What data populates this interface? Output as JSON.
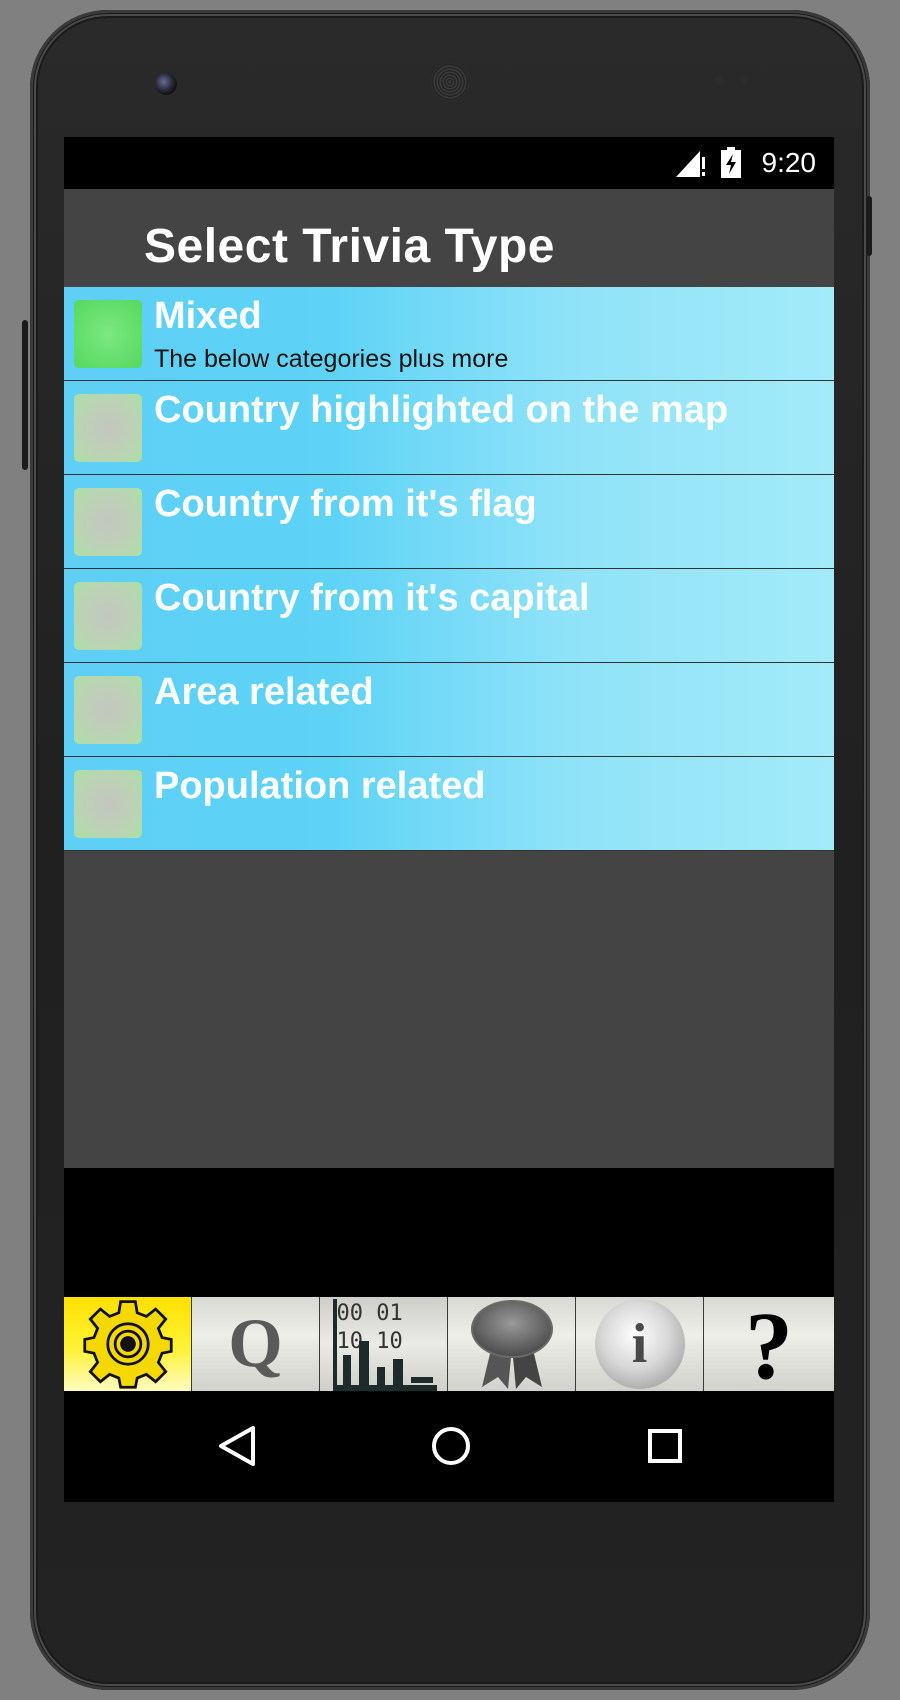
{
  "status_bar": {
    "time": "9:20",
    "icons": [
      "signal-icon",
      "battery-icon"
    ]
  },
  "header": {
    "title": "Select Trivia Type"
  },
  "trivia_types": [
    {
      "title": "Mixed",
      "subtitle": "The below categories plus more",
      "checked": true
    },
    {
      "title": "Country highlighted on the map",
      "subtitle": "",
      "checked": false
    },
    {
      "title": "Country from it's flag",
      "subtitle": "",
      "checked": false
    },
    {
      "title": "Country from it's capital",
      "subtitle": "",
      "checked": false
    },
    {
      "title": "Area related",
      "subtitle": "",
      "checked": false
    },
    {
      "title": "Population related",
      "subtitle": "",
      "checked": false
    }
  ],
  "toolbar": {
    "buttons": [
      {
        "icon": "settings-gear-icon",
        "active": true
      },
      {
        "icon": "quiz-q-icon",
        "glyph": "Q"
      },
      {
        "icon": "stats-chart-icon",
        "glyph_rows": [
          "00 01",
          "10 10"
        ]
      },
      {
        "icon": "award-ribbon-icon"
      },
      {
        "icon": "info-icon",
        "glyph": "i"
      },
      {
        "icon": "help-icon",
        "glyph": "?"
      }
    ]
  },
  "nav_bar": {
    "icons": [
      "back-icon",
      "home-icon",
      "recents-icon"
    ]
  },
  "colors": {
    "list_gradient_start": "#5fcff5",
    "list_gradient_end": "#a3ebf9",
    "checked_box": "#66df6e",
    "unchecked_box": "#bcd2b6",
    "title_bar": "#444444",
    "active_tool": "#ffe100"
  }
}
